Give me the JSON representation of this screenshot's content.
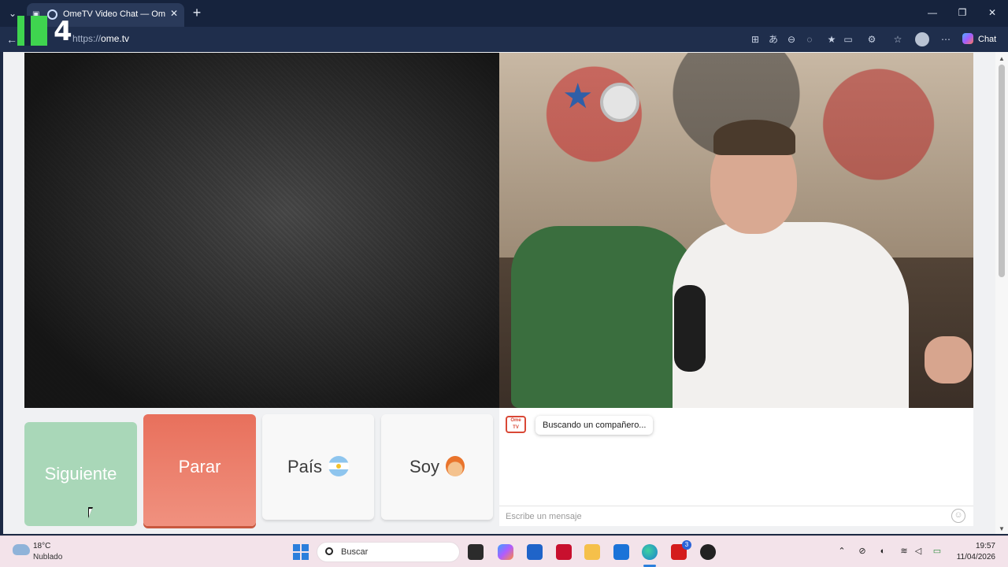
{
  "browser": {
    "tab_title": "OmeTV Video Chat — Omegl",
    "url_scheme": "https://",
    "url_host": "ome.tv",
    "chat_label": "Chat"
  },
  "channel_logo": "K4",
  "controls": {
    "next_label": "Siguiente",
    "stop_label": "Parar",
    "country_label": "País",
    "gender_label": "Soy"
  },
  "chat": {
    "status_message": "Buscando un compañero...",
    "logo_text": "Ome TV",
    "input_placeholder": "Escribe un mensaje"
  },
  "taskbar": {
    "weather_temp": "18°C",
    "weather_desc": "Nublado",
    "search_placeholder": "Buscar",
    "time": "19:57",
    "date": "11/04/2026",
    "badge_count": "3"
  },
  "colors": {
    "next_button": "#a9d7b8",
    "stop_button": "#e8705c",
    "accent": "#2b7fdc"
  }
}
